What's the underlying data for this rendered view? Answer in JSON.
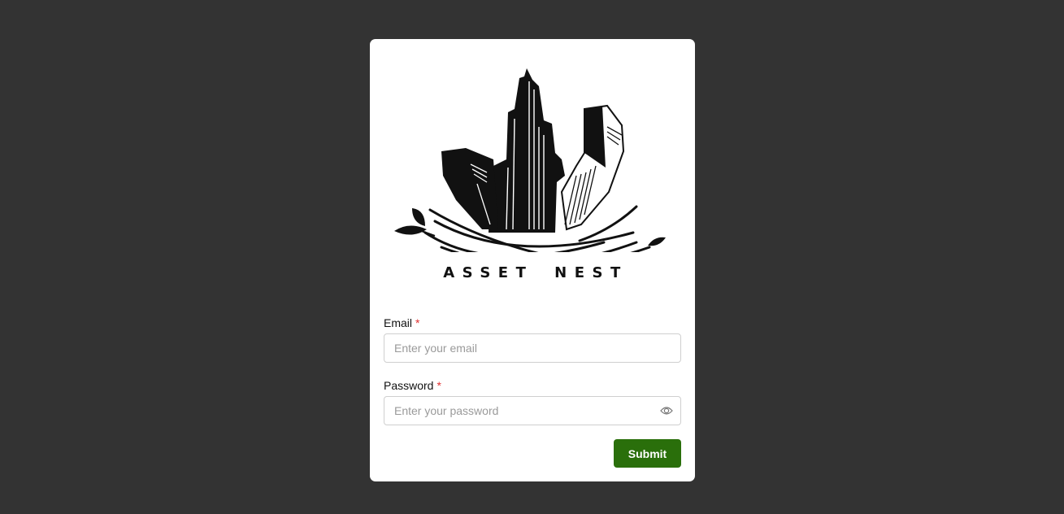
{
  "brand": {
    "name": "ASSET NEST"
  },
  "form": {
    "email": {
      "label": "Email",
      "required_mark": "*",
      "placeholder": "Enter your email",
      "value": ""
    },
    "password": {
      "label": "Password",
      "required_mark": "*",
      "placeholder": "Enter your password",
      "value": "",
      "toggle_icon": "eye-icon"
    },
    "submit_label": "Submit"
  },
  "colors": {
    "background": "#333333",
    "card": "#ffffff",
    "accent": "#2a6f0b",
    "required": "#e03131"
  }
}
